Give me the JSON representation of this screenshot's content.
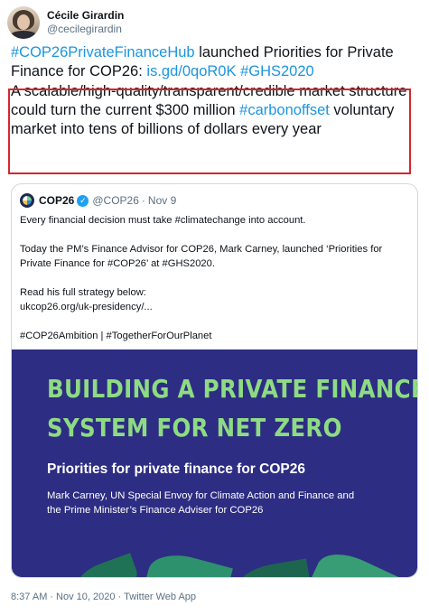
{
  "author": {
    "display_name": "Cécile Girardin",
    "handle": "@cecilegirardin"
  },
  "tweet": {
    "intro": {
      "tag1": "#COP26PrivateFinanceHub",
      "text1": " launched Priorities for Private Finance for COP26: ",
      "link": "is.gd/0qoR0K",
      "text2": " ",
      "tag2": "#GHS2020"
    },
    "highlighted": {
      "text1": "A scalable/high-quality/transparent/credible market structure could turn the current $300 million ",
      "tag": "#carbonoffset",
      "text2": " voluntary market into tens of billions of dollars every year"
    }
  },
  "quoted": {
    "name": "COP26",
    "verified_mark": "✓",
    "handle": "@COP26",
    "dot": "·",
    "date": "Nov 9",
    "lines": [
      "Every financial decision must take #climatechange into account.",
      "Today the PM’s Finance Advisor for COP26, Mark Carney, launched ‘Priorities for",
      "Private Finance for #COP26’ at #GHS2020.",
      "Read his full strategy below:",
      "ukcop26.org/uk-presidency/...",
      "#COP26Ambition | #TogetherForOurPlanet"
    ],
    "banner": {
      "title_line1": "BUILDING A PRIVATE FINANCE",
      "title_line2": "SYSTEM FOR NET ZERO",
      "subtitle": "Priorities for private finance for COP26",
      "credit_line1": "Mark Carney, UN Special Envoy for Climate Action and Finance and",
      "credit_line2": "the Prime Minister’s Finance Adviser for COP26"
    }
  },
  "footer": {
    "time": "8:37 AM",
    "sep": "·",
    "date": "Nov 10, 2020",
    "source": "Twitter Web App"
  },
  "colors": {
    "link": "#1b95e0",
    "highlight_border": "#d7262c",
    "banner_bg": "#2d2d83",
    "banner_title": "#8edb83"
  }
}
